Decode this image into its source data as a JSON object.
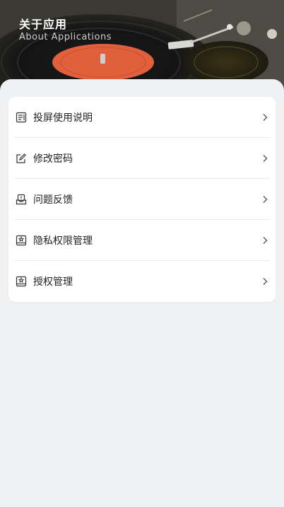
{
  "header": {
    "title": "关于应用",
    "subtitle": "About Applications"
  },
  "menu": {
    "items": [
      {
        "label": "投屏使用说明",
        "icon": "document-icon"
      },
      {
        "label": "修改密码",
        "icon": "edit-icon"
      },
      {
        "label": "问题反馈",
        "icon": "feedback-icon"
      },
      {
        "label": "隐私权限管理",
        "icon": "privacy-icon"
      },
      {
        "label": "授权管理",
        "icon": "authorization-icon"
      }
    ]
  },
  "colors": {
    "background": "#f0f1f3",
    "card": "#ffffff",
    "record_label": "#e0603c",
    "text": "#222222"
  }
}
